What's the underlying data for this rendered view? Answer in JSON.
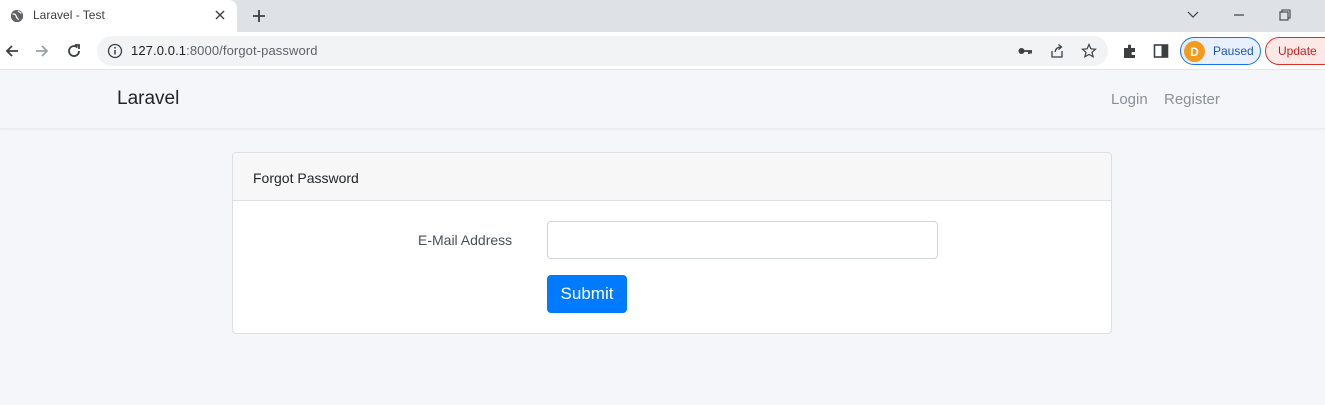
{
  "browser": {
    "tab_title": "Laravel - Test",
    "url_host": "127.0.0.1",
    "url_rest": ":8000/forgot-password",
    "profile_label": "Paused",
    "profile_initial": "D",
    "update_label": "Update"
  },
  "nav": {
    "brand": "Laravel",
    "login": "Login",
    "register": "Register"
  },
  "card": {
    "header": "Forgot Password",
    "email_label": "E-Mail Address",
    "email_value": "",
    "submit_label": "Submit"
  },
  "colors": {
    "primary": "#007bff",
    "page_bg": "#f4f6f9"
  }
}
